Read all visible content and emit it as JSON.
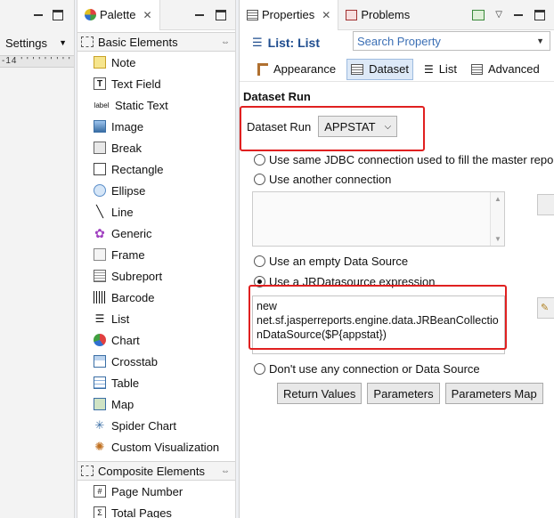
{
  "left": {
    "settings_label": "Settings",
    "ruler_text": "-14 ' ' ' ' ' ' ' ' '"
  },
  "palette": {
    "tab_label": "Palette",
    "basic_group": "Basic Elements",
    "items": [
      "Note",
      "Text Field",
      "Static Text",
      "Image",
      "Break",
      "Rectangle",
      "Ellipse",
      "Line",
      "Generic",
      "Frame",
      "Subreport",
      "Barcode",
      "List",
      "Chart",
      "Crosstab",
      "Table",
      "Map",
      "Spider Chart",
      "Custom Visualization"
    ],
    "composite_group": "Composite Elements",
    "composite_items": [
      "Page Number",
      "Total Pages"
    ]
  },
  "props": {
    "tab_properties": "Properties",
    "tab_problems": "Problems",
    "title": "List: List",
    "search_placeholder": "Search Property",
    "subtabs": [
      "Appearance",
      "Dataset",
      "List",
      "Advanced"
    ],
    "section": "Dataset Run",
    "dataset_label": "Dataset Run",
    "dataset_value": "APPSTAT",
    "opt_same": "Use same JDBC connection used to fill the master repo",
    "opt_another": "Use another connection",
    "opt_empty": "Use an empty Data Source",
    "opt_jr": "Use a JRDatasource expression",
    "expr_lines": [
      "new",
      "net.sf.jasperreports.engine.data.JRBeanCollectio",
      "nDataSource($P{appstat})"
    ],
    "opt_none": "Don't use any connection or Data Source",
    "btn_return": "Return Values",
    "btn_params": "Parameters",
    "btn_params_map": "Parameters Map"
  },
  "colors": {
    "title_blue": "#1f4d8f",
    "highlight_red": "#e02020",
    "active_tab_bg": "#dde9f7"
  }
}
